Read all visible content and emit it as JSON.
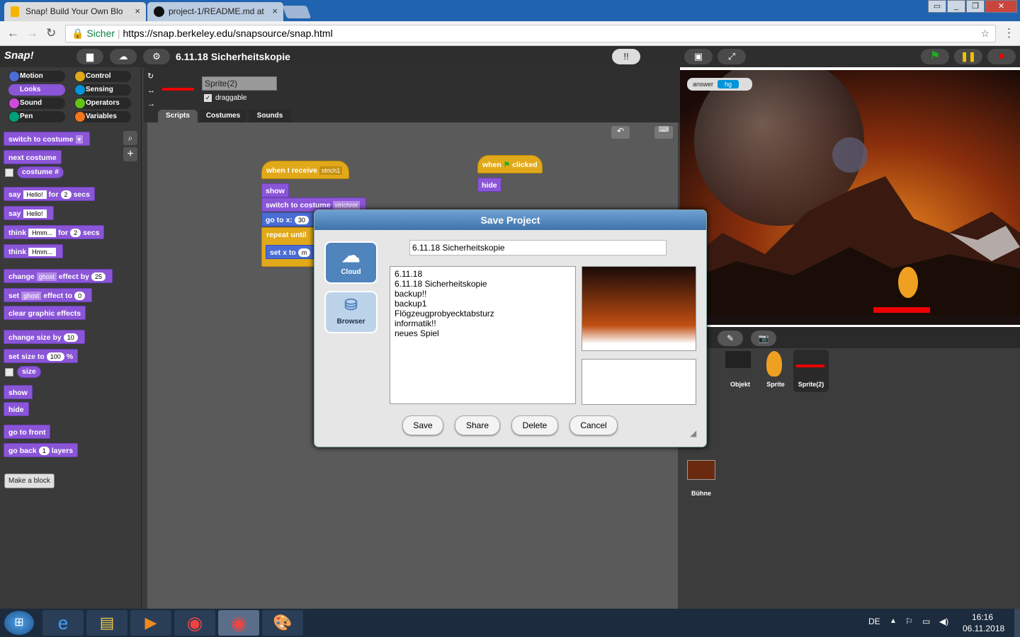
{
  "browser": {
    "tabs": [
      {
        "title": "Snap! Build Your Own Blo",
        "close": "×"
      },
      {
        "title": "project-1/README.md at",
        "close": "×"
      }
    ],
    "url_secure_label": "Sicher",
    "url": "https://snap.berkeley.edu/snapsource/snap.html"
  },
  "snap": {
    "logo": "Snap!",
    "project_title": "6.11.18 Sicherheitskopie",
    "categories": [
      "Motion",
      "Control",
      "Looks",
      "Sensing",
      "Sound",
      "Operators",
      "Pen",
      "Variables"
    ],
    "palette": {
      "switch_to_costume": "switch to costume",
      "next_costume": "next costume",
      "costume_num": "costume #",
      "say": "say",
      "say_text": "Hello!",
      "for": "for",
      "secs_val": "2",
      "secs": "secs",
      "say2": "say",
      "say2_text": "Hello!",
      "think": "think",
      "think_text": "Hmm...",
      "think_for": "for",
      "think_secs_val": "2",
      "think_secs": "secs",
      "think2": "think",
      "think2_text": "Hmm...",
      "change": "change",
      "effect_ghost": "ghost",
      "effect_by": "effect by",
      "effect_by_val": "25",
      "set": "set",
      "set_ghost": "ghost",
      "effect_to": "effect to",
      "effect_to_val": "0",
      "clear_effects": "clear graphic effects",
      "change_size": "change size by",
      "change_size_val": "10",
      "set_size": "set size to",
      "set_size_val": "100",
      "percent": "%",
      "size": "size",
      "show": "show",
      "hide": "hide",
      "go_front": "go to front",
      "go_back": "go back",
      "go_back_val": "1",
      "layers": "layers",
      "make_block": "Make a block"
    },
    "sprite": {
      "name": "Sprite(2)",
      "draggable": "draggable"
    },
    "tabs": [
      "Scripts",
      "Costumes",
      "Sounds"
    ],
    "scripts": {
      "when_receive": "when I receive",
      "receive_msg": "strich1",
      "show": "show",
      "switch_costume": "switch to costume",
      "costume_val": "strichrot",
      "goto": "go to x:",
      "goto_val": "30",
      "repeat_until": "repeat until",
      "set_x": "set x to",
      "when": "when",
      "clicked": "clicked",
      "hide": "hide"
    },
    "stage": {
      "answer_label": "answer",
      "answer_value": "hg"
    },
    "corral": {
      "sprites": [
        "Objekt",
        "Sprite",
        "Sprite(2)"
      ],
      "stage_label": "Bühne"
    }
  },
  "dialog": {
    "title": "Save Project",
    "name_value": "6.11.18 Sicherheitskopie",
    "sources": [
      "Cloud",
      "Browser"
    ],
    "projects": [
      "6.11.18",
      "6.11.18 Sicherheitskopie",
      "backup!!",
      "backup1",
      "Flögzeugprobyecktabsturz",
      "informatik!!",
      "neues Spiel"
    ],
    "buttons": [
      "Save",
      "Share",
      "Delete",
      "Cancel"
    ]
  },
  "taskbar": {
    "lang": "DE",
    "time": "16:16",
    "date": "06.11.2018"
  },
  "colors": {
    "motion": "#4a6cd4",
    "looks": "#8a55d7",
    "control": "#e1a91a",
    "dialog_title": "#4f84bd"
  }
}
